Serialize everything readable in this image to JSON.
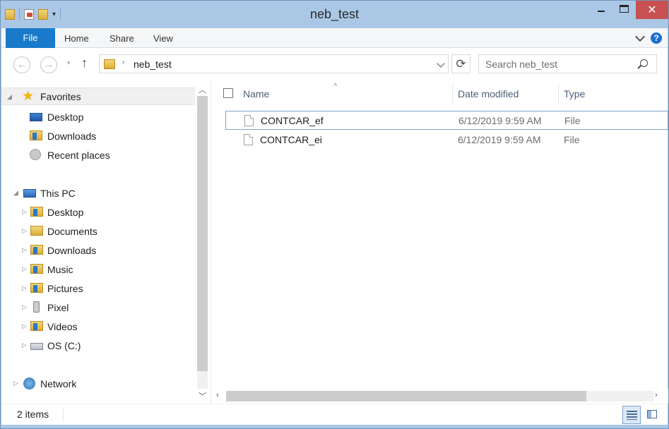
{
  "window": {
    "title": "neb_test"
  },
  "quick_access_toolbar": {
    "icons": [
      "folder-icon",
      "properties-icon",
      "new-folder-icon"
    ],
    "dropdown": "▾"
  },
  "window_controls": {
    "minimize": "minimize",
    "maximize": "maximize",
    "close": "✕"
  },
  "ribbon": {
    "tabs": [
      {
        "label": "File",
        "active": true
      },
      {
        "label": "Home"
      },
      {
        "label": "Share"
      },
      {
        "label": "View"
      }
    ],
    "help": "?"
  },
  "navigation": {
    "back": "←",
    "forward": "→",
    "recent_dropdown": "▾",
    "up": "↑",
    "address": {
      "arrow": "›",
      "path": "neb_test"
    },
    "refresh": "⟳",
    "search": {
      "placeholder": "Search neb_test"
    }
  },
  "nav_pane": {
    "favorites": {
      "label": "Favorites",
      "items": [
        {
          "label": "Desktop"
        },
        {
          "label": "Downloads"
        },
        {
          "label": "Recent places"
        }
      ]
    },
    "this_pc": {
      "label": "This PC",
      "items": [
        {
          "label": "Desktop"
        },
        {
          "label": "Documents"
        },
        {
          "label": "Downloads"
        },
        {
          "label": "Music"
        },
        {
          "label": "Pictures"
        },
        {
          "label": "Pixel"
        },
        {
          "label": "Videos"
        },
        {
          "label": "OS (C:)"
        }
      ]
    },
    "network": {
      "label": "Network"
    }
  },
  "file_list": {
    "columns": [
      "Name",
      "Date modified",
      "Type"
    ],
    "sort_indicator": "˄",
    "rows": [
      {
        "name": "CONTCAR_ef",
        "date": "6/12/2019 9:59 AM",
        "type": "File"
      },
      {
        "name": "CONTCAR_ei",
        "date": "6/12/2019 9:59 AM",
        "type": "File"
      }
    ]
  },
  "status_bar": {
    "item_count": "2 items"
  },
  "colors": {
    "file_tab": "#1979ca",
    "title_bar": "#aac8e6",
    "close_button": "#c75050",
    "header_text": "#4c607a"
  }
}
